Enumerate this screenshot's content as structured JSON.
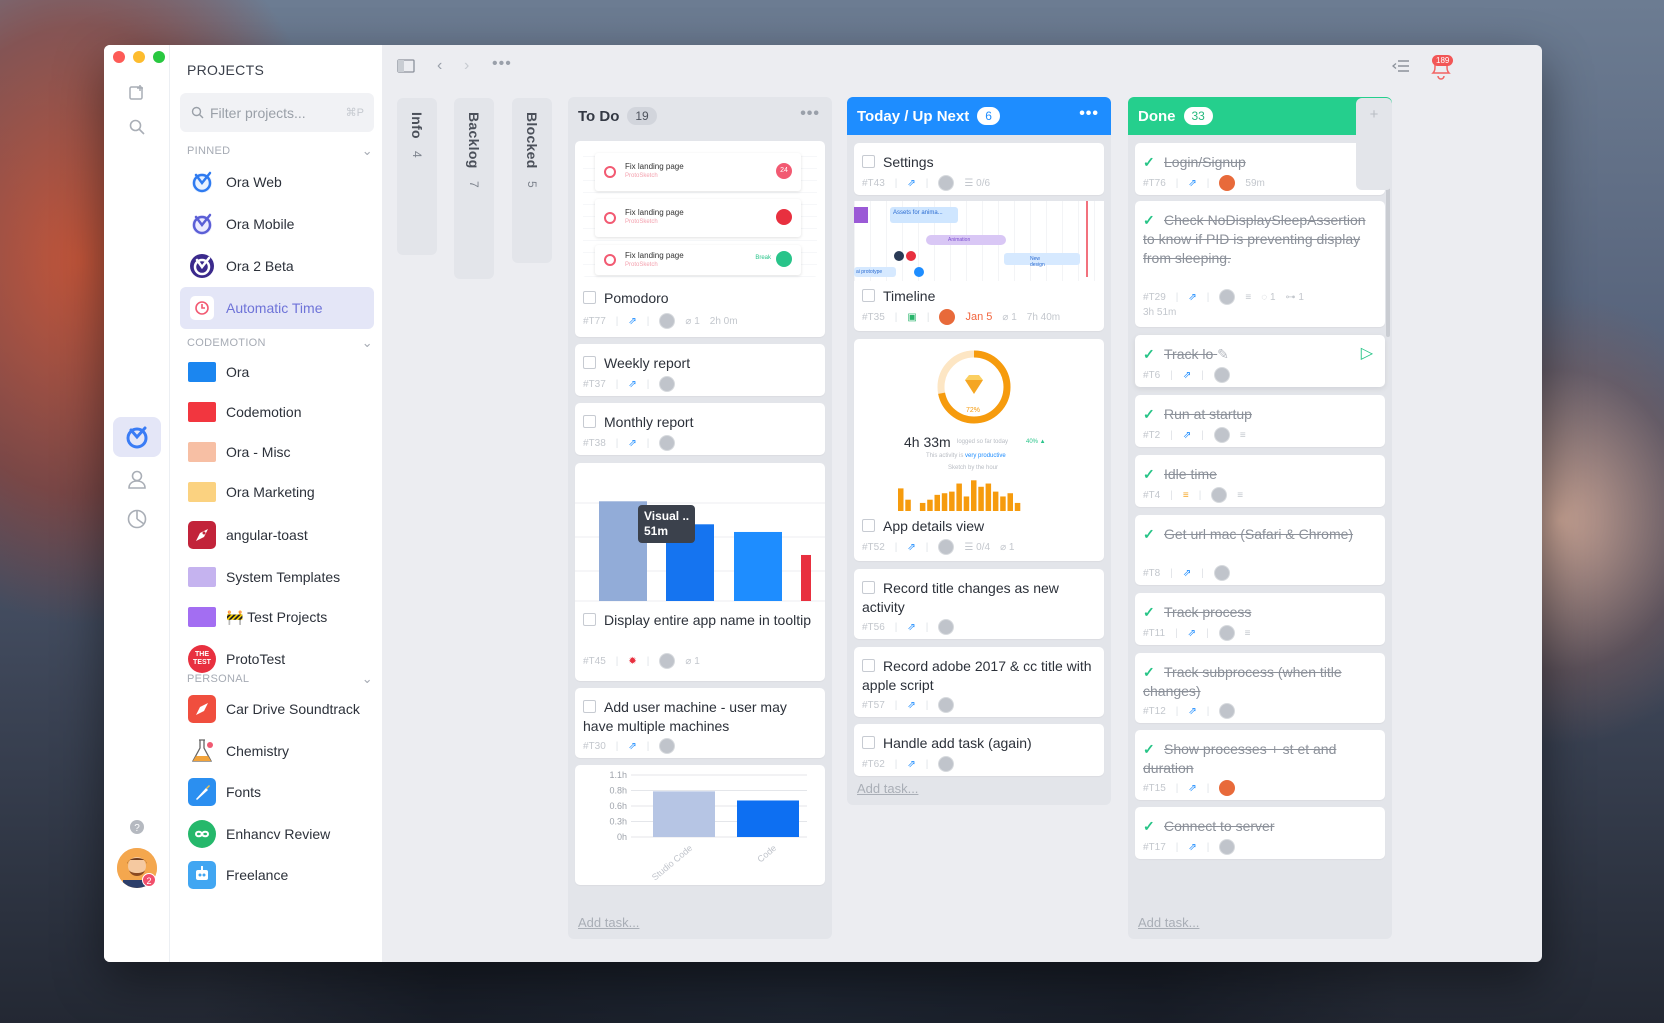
{
  "sidebar": {
    "title": "PROJECTS",
    "filter_placeholder": "Filter projects...",
    "filter_shortcut": "⌘P",
    "groups": [
      {
        "label": "PINNED"
      },
      {
        "label": "CODEMOTION"
      },
      {
        "label": "PERSONAL"
      }
    ],
    "items": [
      {
        "label": "Ora Web",
        "icon": "ora-web-icon"
      },
      {
        "label": "Ora Mobile",
        "icon": "ora-mobile-icon"
      },
      {
        "label": "Ora 2 Beta",
        "icon": "ora-beta-icon"
      },
      {
        "label": "Automatic Time",
        "icon": "automatic-time-icon",
        "selected": true
      },
      {
        "label": "Ora",
        "color": "#1b86f0"
      },
      {
        "label": "Codemotion",
        "color": "#f2363f"
      },
      {
        "label": "Ora - Misc",
        "color": "#f7bfa4"
      },
      {
        "label": "Ora Marketing",
        "color": "#fbd280"
      },
      {
        "label": "angular-toast",
        "icon": "rocket-icon"
      },
      {
        "label": "System Templates",
        "color": "#c5b3ef"
      },
      {
        "label": "🚧 Test Projects",
        "color": "#a36ef2"
      },
      {
        "label": "ProtoTest",
        "icon": "test-badge-icon",
        "badge": "THE TEST"
      },
      {
        "label": "Car Drive Soundtrack",
        "icon": "rocket-icon"
      },
      {
        "label": "Chemistry",
        "icon": "flask-icon"
      },
      {
        "label": "Fonts",
        "icon": "brush-icon"
      },
      {
        "label": "Enhancv Review",
        "icon": "infinity-icon"
      },
      {
        "label": "Freelance",
        "icon": "robot-icon"
      }
    ]
  },
  "rail": {
    "avatar_badge": "2"
  },
  "topbar": {
    "notifications": "189"
  },
  "collapsed": [
    {
      "title": "Info",
      "count": "4"
    },
    {
      "title": "Backlog",
      "count": "7"
    },
    {
      "title": "Blocked",
      "count": "5"
    }
  ],
  "todo": {
    "title": "To Do",
    "count": "19",
    "add": "Add task...",
    "preview": {
      "rows": [
        {
          "title": "Fix landing page",
          "sub": "ProtoSketch",
          "badge": "24"
        },
        {
          "title": "Fix landing page",
          "sub": "ProtoSketch",
          "badge": ""
        },
        {
          "title": "Fix landing page",
          "sub": "ProtoSketch",
          "badge": "Break"
        }
      ]
    },
    "cards": [
      {
        "title": "Pomodoro",
        "id": "#T77",
        "extra": "1",
        "time": "2h 0m"
      },
      {
        "title": "Weekly report",
        "id": "#T37"
      },
      {
        "title": "Monthly report",
        "id": "#T38"
      },
      {
        "title": "Display entire app name in tooltip",
        "id": "#T45",
        "extra": "1"
      },
      {
        "title": "Add user machine - user may have multiple machines",
        "id": "#T30"
      }
    ],
    "tooltip": {
      "title": "Visual ..",
      "value": "51m"
    }
  },
  "today": {
    "title": "Today / Up Next",
    "count": "6",
    "add": "Add task...",
    "cards": [
      {
        "title": "Settings",
        "id": "#T43",
        "checklist": "0/6"
      },
      {
        "title": "Timeline",
        "id": "#T35",
        "date": "Jan 5",
        "extra": "1",
        "time": "7h 40m"
      },
      {
        "title": "App details view",
        "id": "#T52",
        "checklist": "0/4",
        "extra": "1"
      },
      {
        "title": "Record title changes as new activity",
        "id": "#T56"
      },
      {
        "title": "Record adobe 2017 & cc title with apple script",
        "id": "#T57"
      },
      {
        "title": "Handle add task (again)",
        "id": "#T62"
      }
    ],
    "timeline_labels": [
      "Assets for anima...",
      "Animation",
      "New design",
      "ai prototype"
    ],
    "app_details": {
      "percent": "72%",
      "time": "4h 33m",
      "logged": "logged so far today",
      "delta": "40% ▲",
      "activity_pre": "This activity is",
      "activity_strong": "very productive",
      "subtitle": "Sketch by the hour"
    }
  },
  "done": {
    "title": "Done",
    "count": "33",
    "add": "Add task...",
    "cards": [
      {
        "title": "Login/Signup",
        "id": "#T76",
        "time": "59m"
      },
      {
        "title": "Check NoDisplaySleepAssertion to know if PID is preventing display from sleeping.",
        "id": "#T29",
        "comments": "1",
        "subs": "1",
        "time": "3h 51m"
      },
      {
        "title": "Track lo",
        "id": "#T6"
      },
      {
        "title": "Run at startup",
        "id": "#T2"
      },
      {
        "title": "Idle time",
        "id": "#T4"
      },
      {
        "title": "Get url mac (Safari & Chrome)",
        "id": "#T8"
      },
      {
        "title": "Track process",
        "id": "#T11"
      },
      {
        "title": "Track subprocess (when title changes)",
        "id": "#T12"
      },
      {
        "title": "Show processes + st et and duration",
        "id": "#T15"
      },
      {
        "title": "Connect to server",
        "id": "#T17"
      }
    ]
  },
  "chart_data": [
    {
      "type": "bar",
      "values": [
        0.65,
        0.5,
        0.45,
        0.3
      ]
    },
    {
      "type": "bar",
      "categories": [
        "Studio Code",
        "Code"
      ],
      "values": [
        0.75,
        0.6
      ],
      "ylim": [
        0,
        1.1
      ],
      "ytick_labels": [
        "1.1h",
        "0.8h",
        "0.6h",
        "0.3h",
        "0h"
      ]
    },
    {
      "type": "bar",
      "title": "Sketch by the hour",
      "values": [
        0.7,
        0.35,
        0,
        0.25,
        0.35,
        0.5,
        0.55,
        0.6,
        0.85,
        0.45,
        0.95,
        0.75,
        0.85,
        0.6,
        0.45,
        0.55,
        0.25
      ]
    }
  ]
}
